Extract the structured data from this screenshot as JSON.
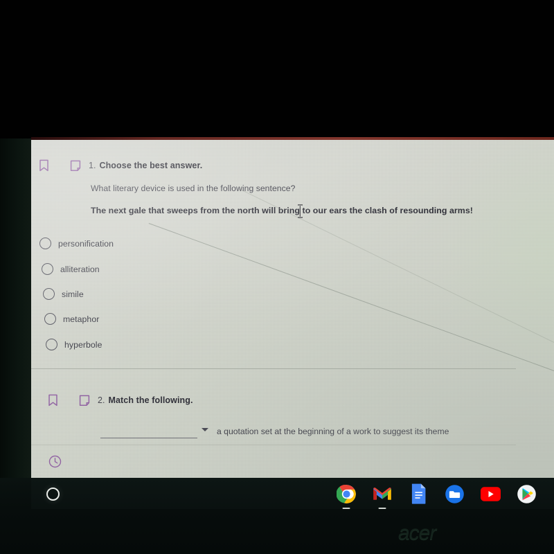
{
  "device": {
    "brand_logo": "acer",
    "bezel_color": "#050a09",
    "screen_glare": true
  },
  "quiz": {
    "questions": [
      {
        "number": "1.",
        "title": "Choose the best answer.",
        "prompt": "What literary device is used in the following sentence?",
        "sentence": "The next gale that sweeps from the north will bring to our ears the clash of resounding arms!",
        "bookmark_icon": "bookmark-icon",
        "note_icon": "note-icon",
        "options": [
          {
            "label": "personification",
            "selected": false
          },
          {
            "label": "alliteration",
            "selected": false
          },
          {
            "label": "simile",
            "selected": false
          },
          {
            "label": "metaphor",
            "selected": false
          },
          {
            "label": "hyperbole",
            "selected": false
          }
        ]
      },
      {
        "number": "2.",
        "title": "Match the following.",
        "bookmark_icon": "bookmark-icon",
        "note_icon": "note-icon",
        "match_rows": [
          {
            "select_value": "",
            "select_placeholder": "",
            "text": "a quotation set at the beginning of a work to suggest its theme"
          }
        ]
      }
    ],
    "timer_icon": "clock-icon",
    "accent_color": "#8e5fa0"
  },
  "shelf": {
    "launcher_label": "launcher-circle",
    "apps": [
      {
        "name": "Chrome",
        "icon": "chrome-icon",
        "running": true
      },
      {
        "name": "Gmail",
        "icon": "gmail-icon",
        "running": true
      },
      {
        "name": "Docs",
        "icon": "docs-icon",
        "running": false
      },
      {
        "name": "Files",
        "icon": "files-icon",
        "running": false
      },
      {
        "name": "YouTube",
        "icon": "youtube-icon",
        "running": false
      },
      {
        "name": "Play Store",
        "icon": "play-icon",
        "running": false
      }
    ]
  }
}
